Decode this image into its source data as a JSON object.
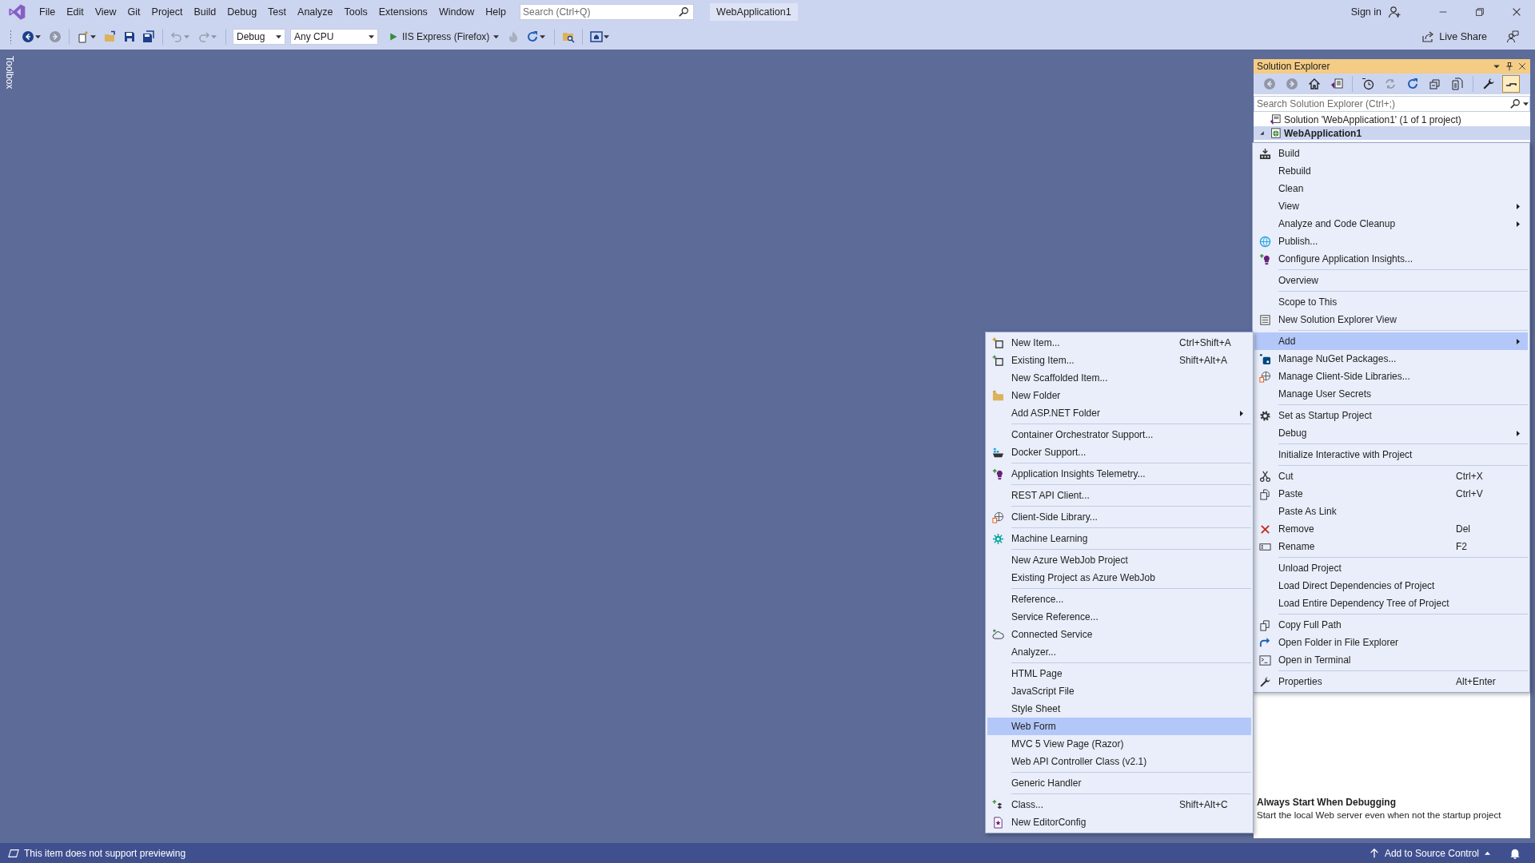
{
  "title_bar": {
    "menus": [
      "File",
      "Edit",
      "View",
      "Git",
      "Project",
      "Build",
      "Debug",
      "Test",
      "Analyze",
      "Tools",
      "Extensions",
      "Window",
      "Help"
    ],
    "search": {
      "placeholder": "Search (Ctrl+Q)"
    },
    "solution_name": "WebApplication1",
    "sign_in": "Sign in"
  },
  "toolbar": {
    "items": [
      {
        "kind": "button",
        "disabled": false,
        "dropdown": true
      },
      {
        "kind": "button",
        "disabled": true,
        "dropdown": false
      },
      {
        "kind": "separator"
      },
      {
        "kind": "button",
        "disabled": false,
        "dropdown": true
      },
      {
        "kind": "button",
        "disabled": false,
        "dropdown": false
      },
      {
        "kind": "button",
        "disabled": false,
        "dropdown": false
      },
      {
        "kind": "button",
        "disabled": false,
        "dropdown": false
      },
      {
        "kind": "separator"
      },
      {
        "kind": "button",
        "disabled": true,
        "dropdown": true
      },
      {
        "kind": "button",
        "disabled": true,
        "dropdown": true
      },
      {
        "kind": "separator"
      },
      {
        "kind": "combo",
        "text": "Debug"
      },
      {
        "kind": "combo",
        "text": "Any CPU"
      },
      {
        "kind": "run",
        "text": "IIS Express (Firefox)"
      },
      {
        "kind": "button",
        "disabled": true,
        "dropdown": false
      },
      {
        "kind": "button",
        "disabled": false,
        "dropdown": true
      },
      {
        "kind": "separator"
      },
      {
        "kind": "button",
        "disabled": false,
        "dropdown": false
      },
      {
        "kind": "separator"
      },
      {
        "kind": "button",
        "disabled": false,
        "dropdown": true
      }
    ],
    "live_share": "Live Share"
  },
  "toolbox_tab": "Toolbox",
  "solution_explorer": {
    "title": "Solution Explorer",
    "toolbar": [
      {
        "kind": "button",
        "disabled": true,
        "on": false
      },
      {
        "kind": "button",
        "disabled": true,
        "on": false
      },
      {
        "kind": "button",
        "disabled": false,
        "on": false
      },
      {
        "kind": "button",
        "disabled": false,
        "on": false
      },
      {
        "kind": "separator"
      },
      {
        "kind": "button",
        "disabled": false,
        "on": false
      },
      {
        "kind": "button",
        "disabled": true,
        "on": false
      },
      {
        "kind": "button",
        "disabled": false,
        "on": false
      },
      {
        "kind": "button",
        "disabled": false,
        "on": false
      },
      {
        "kind": "button",
        "disabled": false,
        "on": false
      },
      {
        "kind": "separator"
      },
      {
        "kind": "button",
        "disabled": false,
        "on": false
      },
      {
        "kind": "button",
        "disabled": false,
        "on": true
      }
    ],
    "search": {
      "placeholder": "Search Solution Explorer (Ctrl+;)"
    },
    "tree": [
      {
        "label": "Solution 'WebApplication1' (1 of 1 project)",
        "selected": false,
        "children": [
          {
            "label": "WebApplication1",
            "selected": true,
            "expanded": true
          }
        ]
      }
    ],
    "properties": {
      "name": "Always Start When Debugging",
      "description": "Start the local Web server even when not the startup project"
    }
  },
  "context_menu": {
    "groups": [
      {
        "items": [
          {
            "label": "Build",
            "submenu": false,
            "selected": false
          },
          {
            "label": "Rebuild",
            "submenu": false,
            "selected": false
          },
          {
            "label": "Clean",
            "submenu": false,
            "selected": false
          },
          {
            "label": "View",
            "submenu": true,
            "selected": false
          },
          {
            "label": "Analyze and Code Cleanup",
            "submenu": true,
            "selected": false
          },
          {
            "label": "Publish...",
            "submenu": false,
            "selected": false
          },
          {
            "label": "Configure Application Insights...",
            "submenu": false,
            "selected": false
          }
        ]
      },
      {
        "items": [
          {
            "label": "Overview",
            "submenu": false,
            "selected": false
          }
        ]
      },
      {
        "items": [
          {
            "label": "Scope to This",
            "submenu": false,
            "selected": false
          },
          {
            "label": "New Solution Explorer View",
            "submenu": false,
            "selected": false
          }
        ]
      },
      {
        "items": [
          {
            "label": "Add",
            "submenu": true,
            "selected": true
          },
          {
            "label": "Manage NuGet Packages...",
            "submenu": false,
            "selected": false
          },
          {
            "label": "Manage Client-Side Libraries...",
            "submenu": false,
            "selected": false
          },
          {
            "label": "Manage User Secrets",
            "submenu": false,
            "selected": false
          }
        ]
      },
      {
        "items": [
          {
            "label": "Set as Startup Project",
            "submenu": false,
            "selected": false
          },
          {
            "label": "Debug",
            "submenu": true,
            "selected": false
          }
        ]
      },
      {
        "items": [
          {
            "label": "Initialize Interactive with Project",
            "submenu": false,
            "selected": false
          }
        ]
      },
      {
        "items": [
          {
            "label": "Cut",
            "shortcut": "Ctrl+X",
            "submenu": false,
            "selected": false
          },
          {
            "label": "Paste",
            "shortcut": "Ctrl+V",
            "submenu": false,
            "selected": false
          },
          {
            "label": "Paste As Link",
            "submenu": false,
            "selected": false
          },
          {
            "label": "Remove",
            "shortcut": "Del",
            "submenu": false,
            "selected": false
          },
          {
            "label": "Rename",
            "shortcut": "F2",
            "submenu": false,
            "selected": false
          }
        ]
      },
      {
        "items": [
          {
            "label": "Unload Project",
            "submenu": false,
            "selected": false
          },
          {
            "label": "Load Direct Dependencies of Project",
            "submenu": false,
            "selected": false
          },
          {
            "label": "Load Entire Dependency Tree of Project",
            "submenu": false,
            "selected": false
          }
        ]
      },
      {
        "items": [
          {
            "label": "Copy Full Path",
            "submenu": false,
            "selected": false
          },
          {
            "label": "Open Folder in File Explorer",
            "submenu": false,
            "selected": false
          },
          {
            "label": "Open in Terminal",
            "submenu": false,
            "selected": false
          }
        ]
      },
      {
        "items": [
          {
            "label": "Properties",
            "shortcut": "Alt+Enter",
            "submenu": false,
            "selected": false
          }
        ]
      }
    ]
  },
  "add_submenu": {
    "groups": [
      {
        "items": [
          {
            "label": "New Item...",
            "shortcut": "Ctrl+Shift+A",
            "submenu": false,
            "selected": false
          },
          {
            "label": "Existing Item...",
            "shortcut": "Shift+Alt+A",
            "submenu": false,
            "selected": false
          },
          {
            "label": "New Scaffolded Item...",
            "submenu": false,
            "selected": false
          },
          {
            "label": "New Folder",
            "submenu": false,
            "selected": false
          },
          {
            "label": "Add ASP.NET Folder",
            "submenu": true,
            "selected": false
          }
        ]
      },
      {
        "items": [
          {
            "label": "Container Orchestrator Support...",
            "submenu": false,
            "selected": false
          },
          {
            "label": "Docker Support...",
            "submenu": false,
            "selected": false
          }
        ]
      },
      {
        "items": [
          {
            "label": "Application Insights Telemetry...",
            "submenu": false,
            "selected": false
          }
        ]
      },
      {
        "items": [
          {
            "label": "REST API Client...",
            "submenu": false,
            "selected": false
          }
        ]
      },
      {
        "items": [
          {
            "label": "Client-Side Library...",
            "submenu": false,
            "selected": false
          }
        ]
      },
      {
        "items": [
          {
            "label": "Machine Learning",
            "submenu": false,
            "selected": false
          }
        ]
      },
      {
        "items": [
          {
            "label": "New Azure WebJob Project",
            "submenu": false,
            "selected": false
          },
          {
            "label": "Existing Project as Azure WebJob",
            "submenu": false,
            "selected": false
          }
        ]
      },
      {
        "items": [
          {
            "label": "Reference...",
            "submenu": false,
            "selected": false
          },
          {
            "label": "Service Reference...",
            "submenu": false,
            "selected": false
          },
          {
            "label": "Connected Service",
            "submenu": false,
            "selected": false
          },
          {
            "label": "Analyzer...",
            "submenu": false,
            "selected": false
          }
        ]
      },
      {
        "items": [
          {
            "label": "HTML Page",
            "submenu": false,
            "selected": false
          },
          {
            "label": "JavaScript File",
            "submenu": false,
            "selected": false
          },
          {
            "label": "Style Sheet",
            "submenu": false,
            "selected": false
          },
          {
            "label": "Web Form",
            "submenu": false,
            "selected": true
          },
          {
            "label": "MVC 5 View Page (Razor)",
            "submenu": false,
            "selected": false
          },
          {
            "label": "Web API Controller Class (v2.1)",
            "submenu": false,
            "selected": false
          }
        ]
      },
      {
        "items": [
          {
            "label": "Generic Handler",
            "submenu": false,
            "selected": false
          }
        ]
      },
      {
        "items": [
          {
            "label": "Class...",
            "shortcut": "Shift+Alt+C",
            "submenu": false,
            "selected": false
          },
          {
            "label": "New EditorConfig",
            "submenu": false,
            "selected": false
          }
        ]
      }
    ]
  },
  "status_bar": {
    "message": "This item does not support previewing",
    "source_control": "Add to Source Control"
  }
}
